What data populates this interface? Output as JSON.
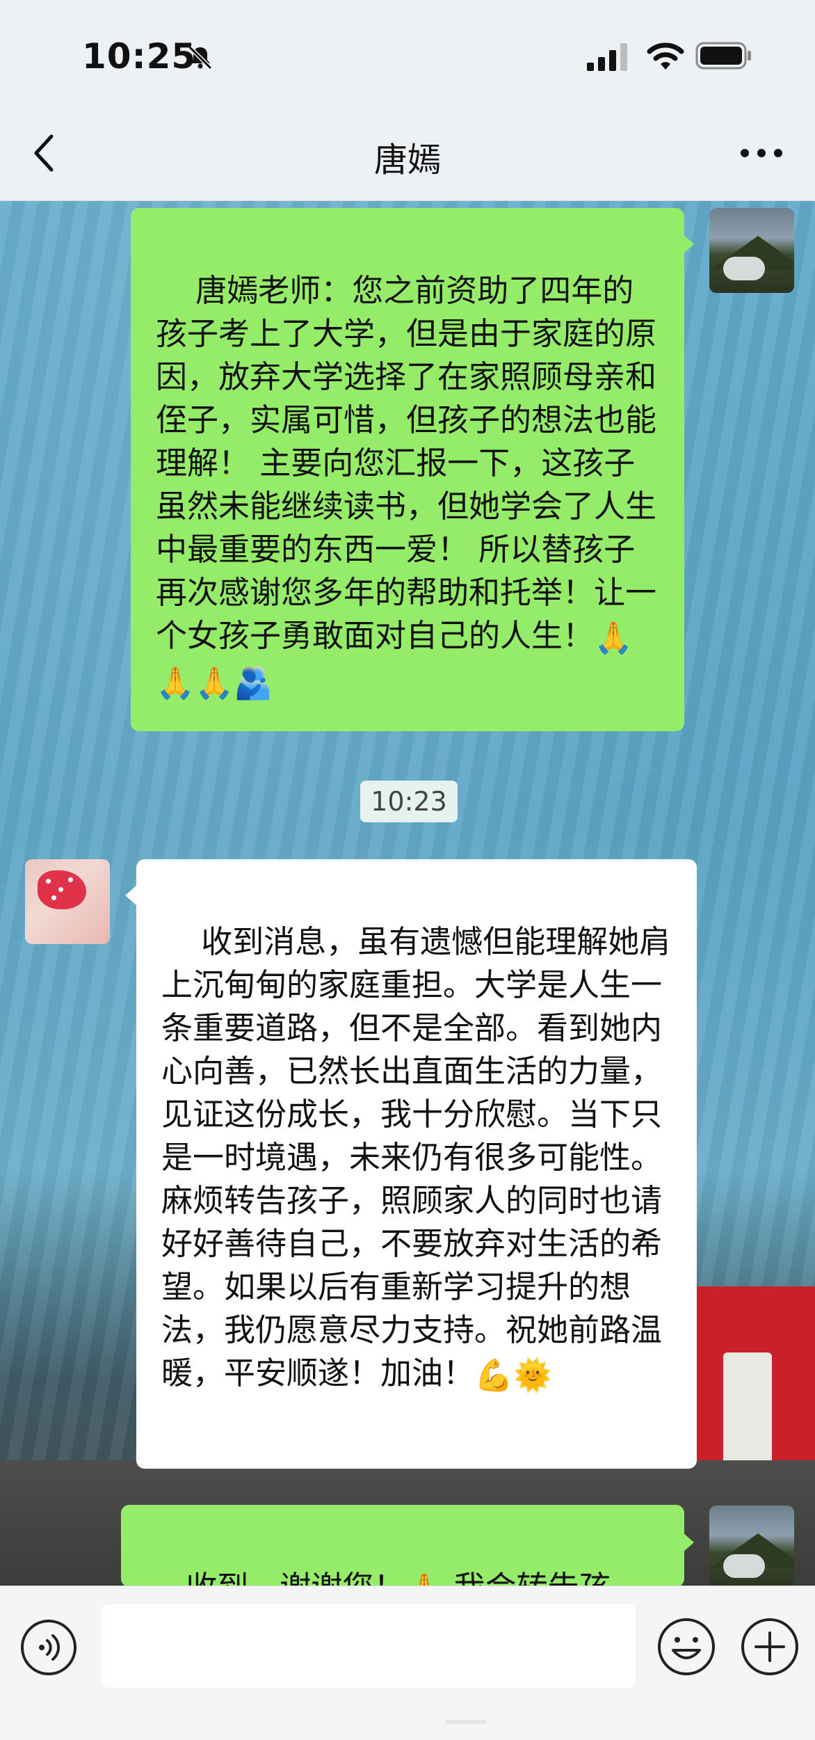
{
  "status_bar": {
    "time": "10:25"
  },
  "nav": {
    "title": "唐嫣"
  },
  "messages": [
    {
      "side": "right",
      "text": "唐嫣老师：您之前资助了四年的孩子考上了大学，但是由于家庭的原因，放弃大学选择了在家照顾母亲和侄子，实属可惜，但孩子的想法也能理解！ 主要向您汇报一下，这孩子虽然未能继续读书，但她学会了人生中最重要的东西一爱！ 所以替孩子再次感谢您多年的帮助和托举！让一个女孩子勇敢面对自己的人生！",
      "emojis": [
        "🙏",
        "🙏",
        "🙏",
        "🫂"
      ]
    },
    {
      "timestamp": "10:23"
    },
    {
      "side": "left",
      "text": "收到消息，虽有遗憾但能理解她肩上沉甸甸的家庭重担。大学是人生一条重要道路，但不是全部。看到她内心向善，已然长出直面生活的力量，见证这份成长，我十分欣慰。当下只是一时境遇，未来仍有很多可能性。麻烦转告孩子，照顾家人的同时也请好好善待自己，不要放弃对生活的希望。如果以后有重新学习提升的想法，我仍愿意尽力支持。祝她前路温暖，平安顺遂！加油！",
      "emojis": [
        "💪",
        "🌞"
      ]
    },
    {
      "side": "right",
      "text_before": "收到，谢谢您！",
      "emoji": "🙏",
      "text_after": " 我会转告孩子！"
    }
  ],
  "input_bar": {
    "text_value": ""
  }
}
